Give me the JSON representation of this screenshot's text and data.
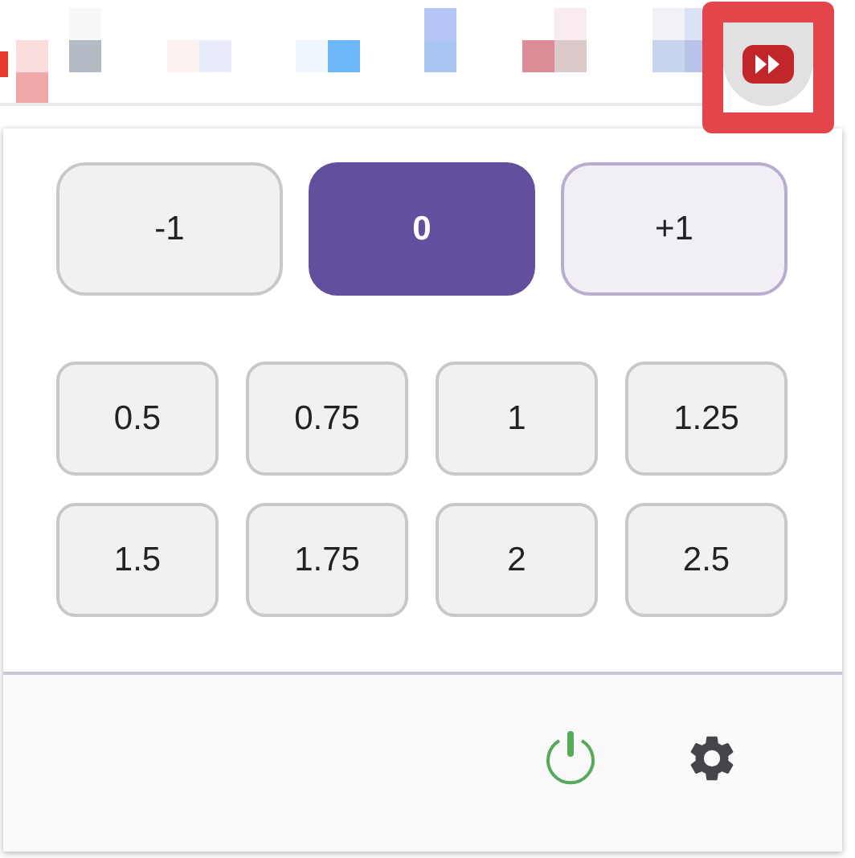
{
  "steps": [
    {
      "label": "-1",
      "selected": false,
      "kind": "minus"
    },
    {
      "label": "0",
      "selected": true,
      "kind": "reset"
    },
    {
      "label": "+1",
      "selected": false,
      "kind": "plus"
    }
  ],
  "presets": [
    "0.5",
    "0.75",
    "1",
    "1.25",
    "1.5",
    "1.75",
    "2",
    "2.5"
  ],
  "footer": {
    "power_on": true
  },
  "extension_button": {
    "highlighted": true
  }
}
